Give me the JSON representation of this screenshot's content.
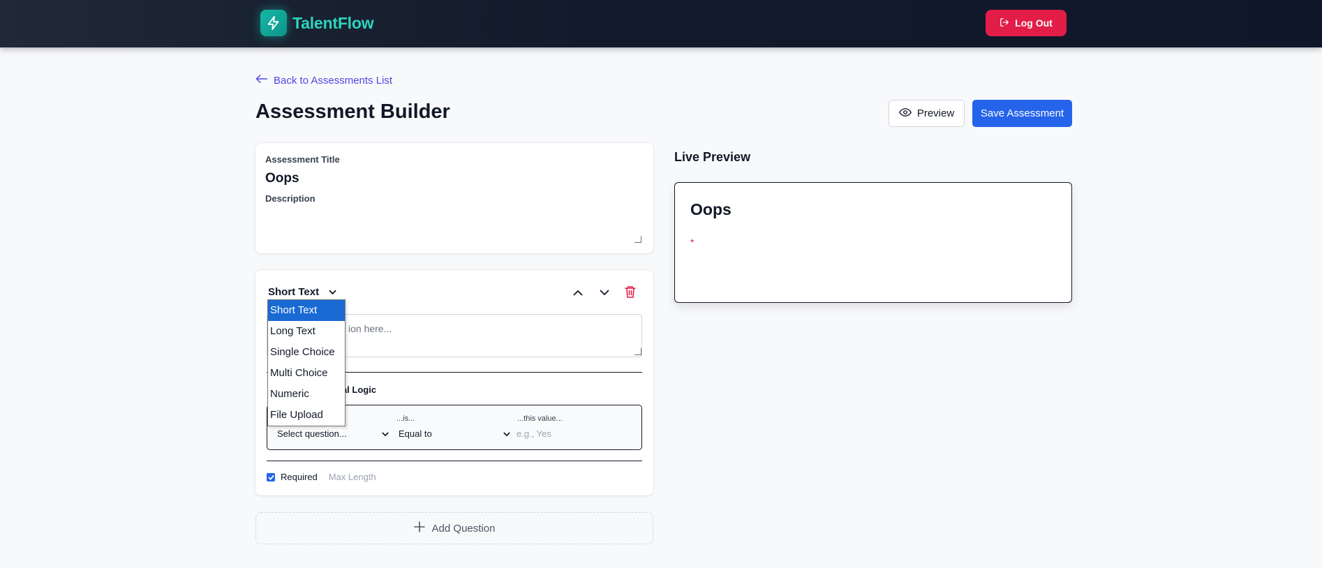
{
  "navbar": {
    "brand_name": "TalentFlow",
    "logout_label": "Log Out"
  },
  "header": {
    "back_label": "Back to Assessments List",
    "page_title": "Assessment Builder",
    "preview_label": "Preview",
    "save_label": "Save Assessment"
  },
  "meta": {
    "title_label": "Assessment Title",
    "title_value": "Oops",
    "description_label": "Description",
    "description_value": ""
  },
  "question": {
    "type_selected": "Short Text",
    "type_options": [
      "Short Text",
      "Long Text",
      "Single Choice",
      "Multi Choice",
      "Numeric",
      "File Upload"
    ],
    "question_placeholder_visible": "ion here...",
    "conditional_title_visible": "nal Logic",
    "cond_is_label": "...is...",
    "cond_value_label": "...this value...",
    "cond_question_value": "Select question...",
    "cond_operator_value": "Equal to",
    "cond_value_placeholder": "e.g., Yes",
    "required_label": "Required",
    "required_checked": true,
    "maxlength_placeholder": "Max Length"
  },
  "add_question_label": "Add Question",
  "live_preview": {
    "section_title": "Live Preview",
    "heading": "Oops",
    "required_marker": "*"
  },
  "colors": {
    "brand": "#2dd4bf",
    "danger": "#e11d48",
    "primary": "#2563eb",
    "link": "#4f46e5"
  }
}
